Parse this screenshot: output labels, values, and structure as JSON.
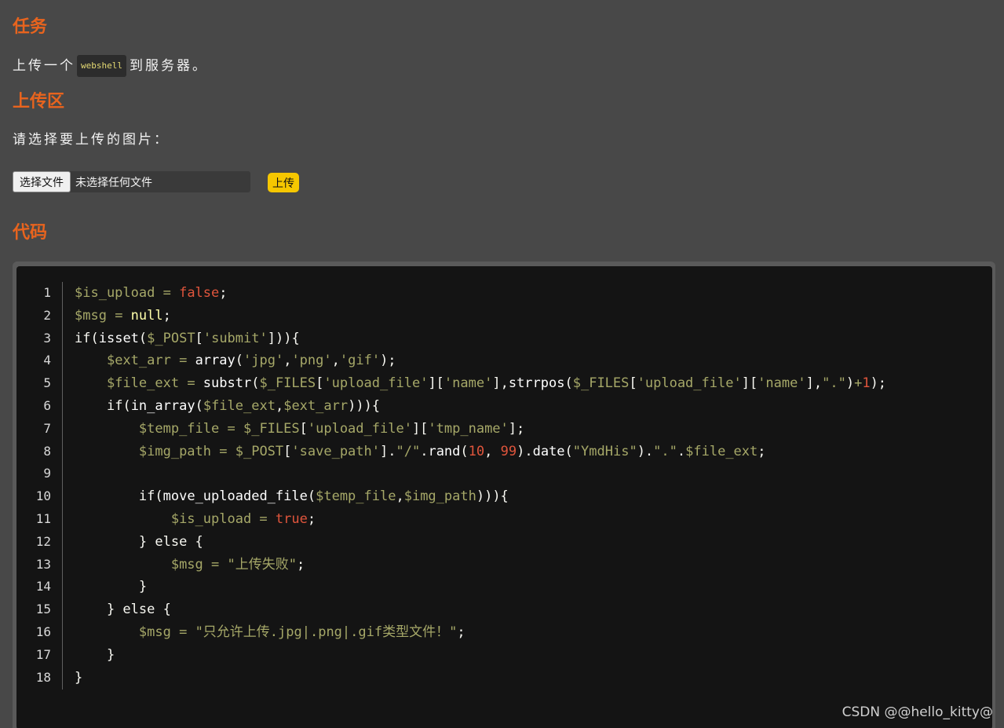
{
  "sections": {
    "task_title": "任务",
    "task_text_before": "上传一个",
    "task_code": "webshell",
    "task_text_after": "到服务器。",
    "upload_title": "上传区",
    "upload_prompt": "请选择要上传的图片：",
    "code_title": "代码"
  },
  "upload_form": {
    "choose_label": "选择文件",
    "no_file_text": "未选择任何文件",
    "submit_label": "上传"
  },
  "code": {
    "line_numbers": [
      "1",
      "2",
      "3",
      "4",
      "5",
      "6",
      "7",
      "8",
      "9",
      "10",
      "11",
      "12",
      "13",
      "14",
      "15",
      "16",
      "17",
      "18"
    ],
    "lines": [
      [
        [
          "var",
          "$is_upload"
        ],
        [
          "op",
          " = "
        ],
        [
          "bool",
          "false"
        ],
        [
          "p",
          ";"
        ]
      ],
      [
        [
          "var",
          "$msg"
        ],
        [
          "op",
          " = "
        ],
        [
          "null",
          "null"
        ],
        [
          "p",
          ";"
        ]
      ],
      [
        [
          "kw",
          "if"
        ],
        [
          "p",
          "("
        ],
        [
          "fn",
          "isset"
        ],
        [
          "p",
          "("
        ],
        [
          "var",
          "$_POST"
        ],
        [
          "p",
          "["
        ],
        [
          "str",
          "'submit'"
        ],
        [
          "p",
          "])){"
        ]
      ],
      [
        [
          "p",
          "    "
        ],
        [
          "var",
          "$ext_arr"
        ],
        [
          "op",
          " = "
        ],
        [
          "fn",
          "array"
        ],
        [
          "p",
          "("
        ],
        [
          "str",
          "'jpg'"
        ],
        [
          "p",
          ","
        ],
        [
          "str",
          "'png'"
        ],
        [
          "p",
          ","
        ],
        [
          "str",
          "'gif'"
        ],
        [
          "p",
          ");"
        ]
      ],
      [
        [
          "p",
          "    "
        ],
        [
          "var",
          "$file_ext"
        ],
        [
          "op",
          " = "
        ],
        [
          "fn",
          "substr"
        ],
        [
          "p",
          "("
        ],
        [
          "var",
          "$_FILES"
        ],
        [
          "p",
          "["
        ],
        [
          "str",
          "'upload_file'"
        ],
        [
          "p",
          "]["
        ],
        [
          "str",
          "'name'"
        ],
        [
          "p",
          "],"
        ],
        [
          "fn",
          "strrpos"
        ],
        [
          "p",
          "("
        ],
        [
          "var",
          "$_FILES"
        ],
        [
          "p",
          "["
        ],
        [
          "str",
          "'upload_file'"
        ],
        [
          "p",
          "]["
        ],
        [
          "str",
          "'name'"
        ],
        [
          "p",
          "],"
        ],
        [
          "str",
          "\".\""
        ],
        [
          "p",
          ")"
        ],
        [
          "op",
          "+"
        ],
        [
          "num",
          "1"
        ],
        [
          "p",
          ");"
        ]
      ],
      [
        [
          "p",
          "    "
        ],
        [
          "kw",
          "if"
        ],
        [
          "p",
          "("
        ],
        [
          "fn",
          "in_array"
        ],
        [
          "p",
          "("
        ],
        [
          "var",
          "$file_ext"
        ],
        [
          "p",
          ","
        ],
        [
          "var",
          "$ext_arr"
        ],
        [
          "p",
          "))){"
        ]
      ],
      [
        [
          "p",
          "        "
        ],
        [
          "var",
          "$temp_file"
        ],
        [
          "op",
          " = "
        ],
        [
          "var",
          "$_FILES"
        ],
        [
          "p",
          "["
        ],
        [
          "str",
          "'upload_file'"
        ],
        [
          "p",
          "]["
        ],
        [
          "str",
          "'tmp_name'"
        ],
        [
          "p",
          "];"
        ]
      ],
      [
        [
          "p",
          "        "
        ],
        [
          "var",
          "$img_path"
        ],
        [
          "op",
          " = "
        ],
        [
          "var",
          "$_POST"
        ],
        [
          "p",
          "["
        ],
        [
          "str",
          "'save_path'"
        ],
        [
          "p",
          "]."
        ],
        [
          "str",
          "\"/\""
        ],
        [
          "p",
          "."
        ],
        [
          "fn",
          "rand"
        ],
        [
          "p",
          "("
        ],
        [
          "num",
          "10"
        ],
        [
          "p",
          ", "
        ],
        [
          "num",
          "99"
        ],
        [
          "p",
          ")."
        ],
        [
          "fn",
          "date"
        ],
        [
          "p",
          "("
        ],
        [
          "str",
          "\"YmdHis\""
        ],
        [
          "p",
          ")."
        ],
        [
          "str",
          "\".\""
        ],
        [
          "p",
          "."
        ],
        [
          "var",
          "$file_ext"
        ],
        [
          "p",
          ";"
        ]
      ],
      [
        [
          "p",
          " "
        ]
      ],
      [
        [
          "p",
          "        "
        ],
        [
          "kw",
          "if"
        ],
        [
          "p",
          "("
        ],
        [
          "fn",
          "move_uploaded_file"
        ],
        [
          "p",
          "("
        ],
        [
          "var",
          "$temp_file"
        ],
        [
          "p",
          ","
        ],
        [
          "var",
          "$img_path"
        ],
        [
          "p",
          "))){"
        ]
      ],
      [
        [
          "p",
          "            "
        ],
        [
          "var",
          "$is_upload"
        ],
        [
          "op",
          " = "
        ],
        [
          "bool",
          "true"
        ],
        [
          "p",
          ";"
        ]
      ],
      [
        [
          "p",
          "        } "
        ],
        [
          "kw",
          "else"
        ],
        [
          "p",
          " {"
        ]
      ],
      [
        [
          "p",
          "            "
        ],
        [
          "var",
          "$msg"
        ],
        [
          "op",
          " = "
        ],
        [
          "str",
          "\"上传失败\""
        ],
        [
          "p",
          ";"
        ]
      ],
      [
        [
          "p",
          "        }"
        ]
      ],
      [
        [
          "p",
          "    } "
        ],
        [
          "kw",
          "else"
        ],
        [
          "p",
          " {"
        ]
      ],
      [
        [
          "p",
          "        "
        ],
        [
          "var",
          "$msg"
        ],
        [
          "op",
          " = "
        ],
        [
          "str",
          "\"只允许上传.jpg|.png|.gif类型文件！\""
        ],
        [
          "p",
          ";"
        ]
      ],
      [
        [
          "p",
          "    }"
        ]
      ],
      [
        [
          "p",
          "}"
        ]
      ]
    ]
  },
  "watermark": "CSDN @@hello_kitty@"
}
